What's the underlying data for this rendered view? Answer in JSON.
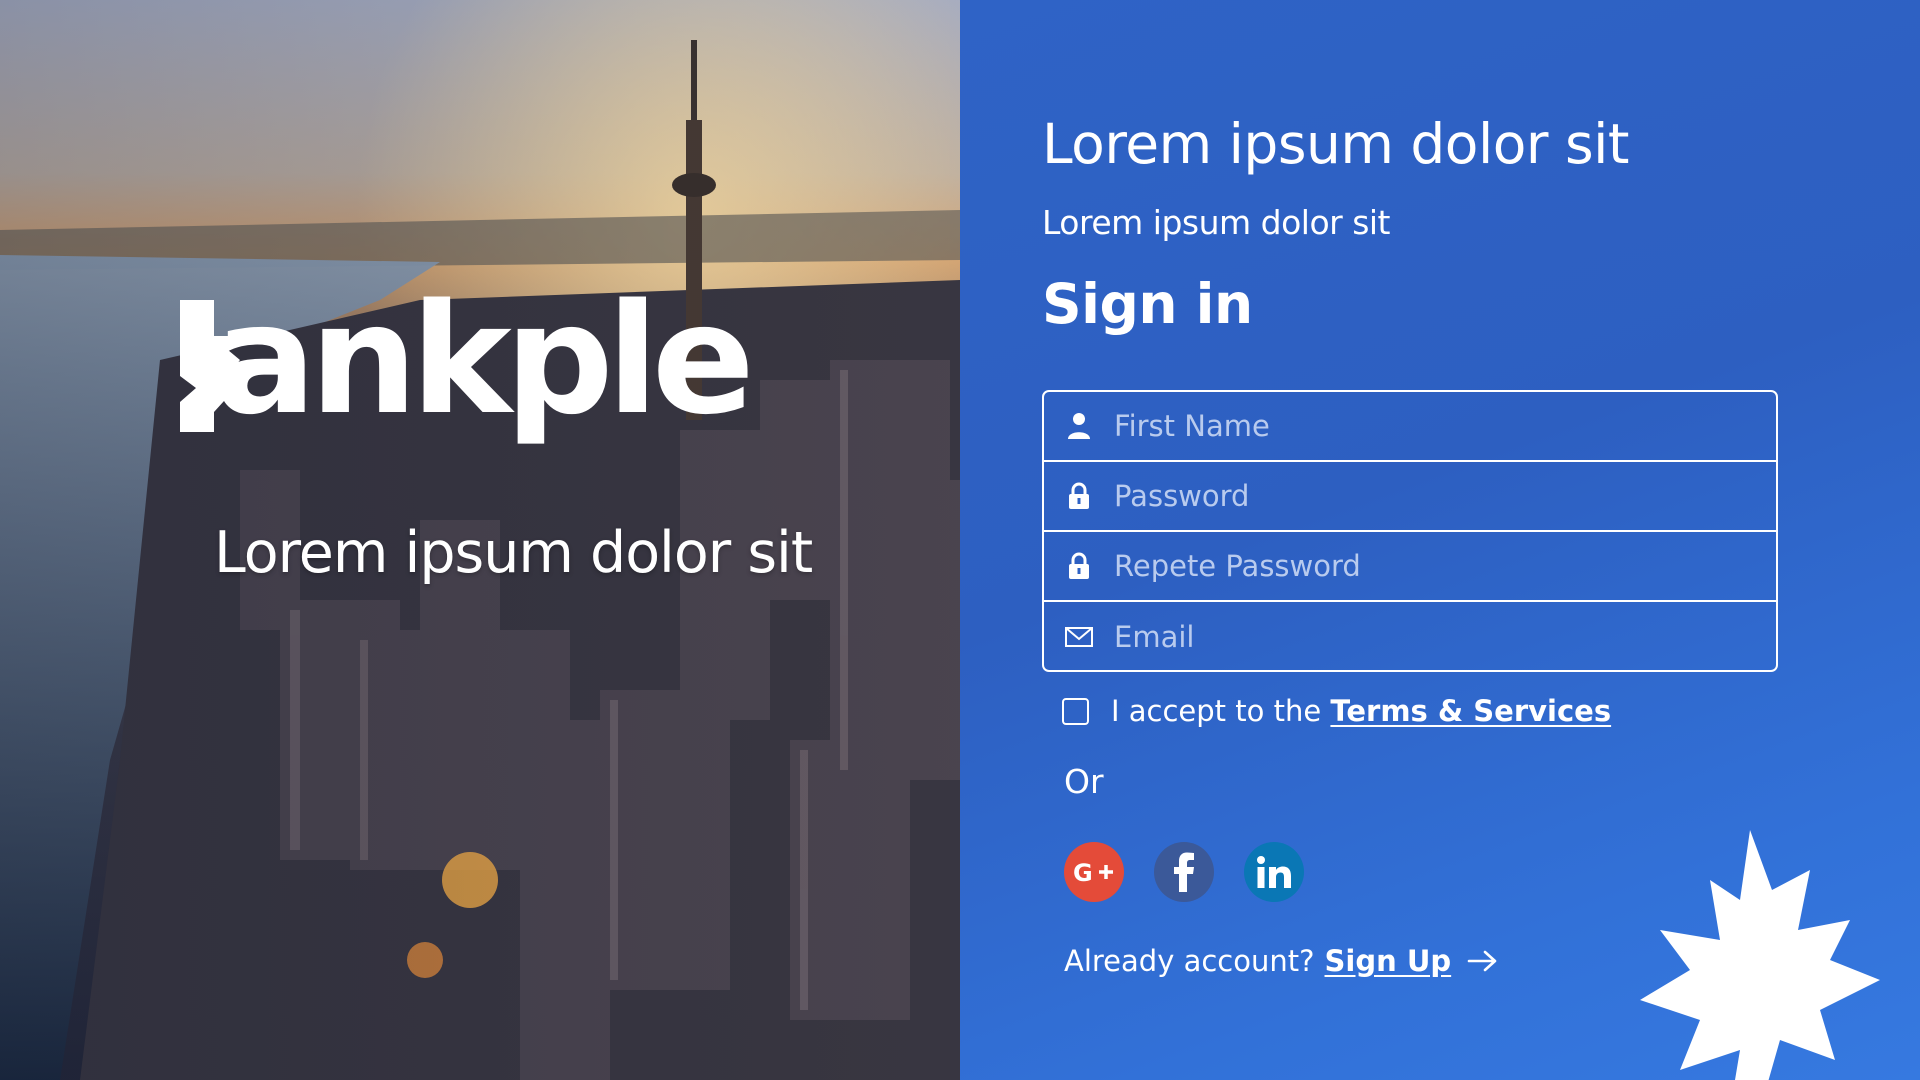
{
  "hero": {
    "brand_name": "ankple",
    "tagline": "Lorem ipsum dolor sit"
  },
  "panel": {
    "title": "Lorem ipsum dolor sit",
    "subtitle": "Lorem ipsum dolor sit",
    "heading": "Sign in"
  },
  "form": {
    "fields": [
      {
        "placeholder": "First Name",
        "icon": "user-icon"
      },
      {
        "placeholder": "Password",
        "icon": "lock-icon"
      },
      {
        "placeholder": "Repete Password",
        "icon": "lock-icon"
      },
      {
        "placeholder": "Email",
        "icon": "envelope-icon"
      }
    ],
    "terms_prefix": "I accept to the ",
    "terms_link": "Terms & Services",
    "or_label": "Or"
  },
  "social": [
    {
      "name": "google-plus",
      "color": "#e44b39"
    },
    {
      "name": "facebook",
      "color": "#3b5999"
    },
    {
      "name": "linkedin",
      "color": "#0a77b5"
    }
  ],
  "footer": {
    "account_prompt": "Already account?",
    "signup_link": "Sign Up"
  },
  "colors": {
    "panel_blue": "#2d5fc1",
    "text": "#ffffff",
    "placeholder": "#b9cbee"
  }
}
